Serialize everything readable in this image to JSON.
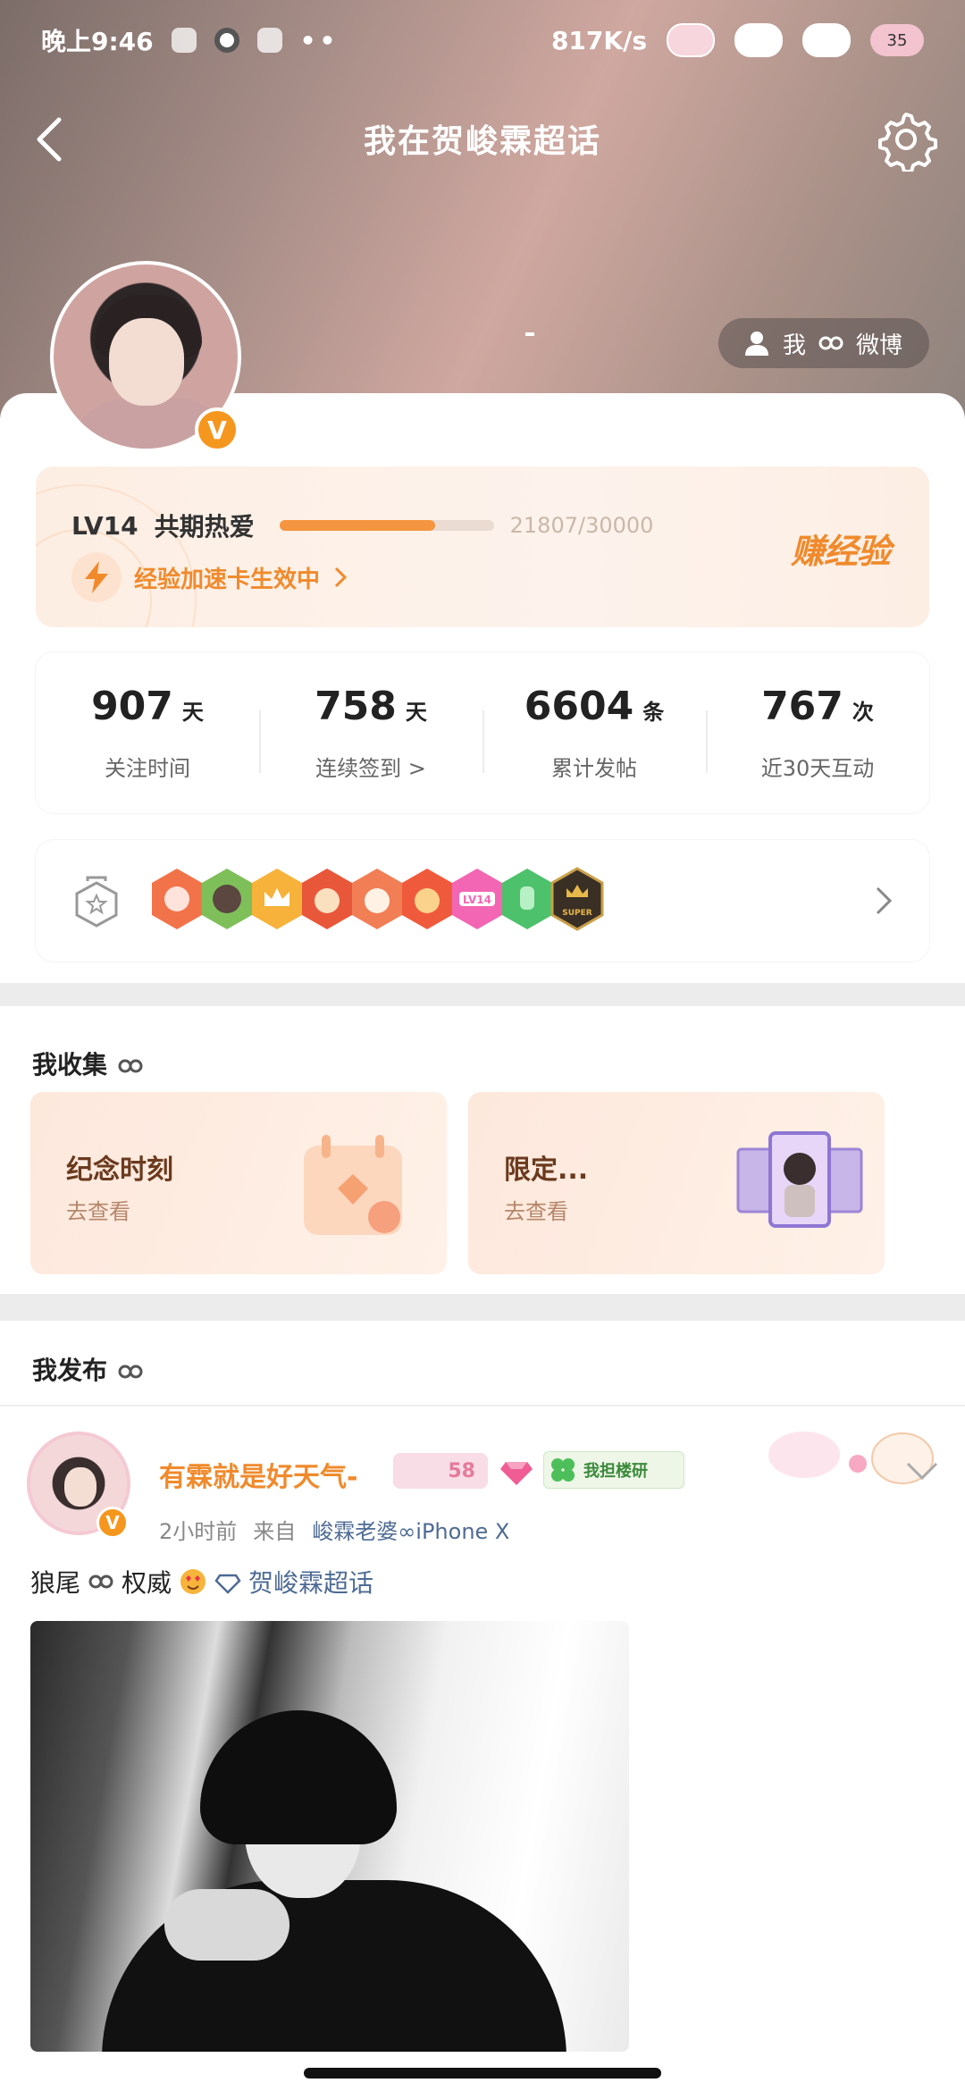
{
  "status_bar": {
    "time": "晚上9:46",
    "dots": "••",
    "network_speed": "817K/s",
    "battery": "35"
  },
  "nav": {
    "title": "我在贺峻霖超话"
  },
  "profile": {
    "weibo_button_label": "我",
    "weibo_button_suffix": "微博",
    "verified_badge": "V"
  },
  "experience": {
    "level": "LV14",
    "level_name": "共期热爱",
    "progress": 0.7269,
    "progress_text": "21807/30000",
    "boost_text": "经验加速卡生效中",
    "earn_label": "赚经验",
    "accent_color": "#f5953f"
  },
  "stats": [
    {
      "value": "907",
      "unit": "天",
      "label": "关注时间"
    },
    {
      "value": "758",
      "unit": "天",
      "label": "连续签到 >"
    },
    {
      "value": "6604",
      "unit": "条",
      "label": "累计发帖"
    },
    {
      "value": "767",
      "unit": "次",
      "label": "近30天互动"
    }
  ],
  "badges": {
    "items": [
      "badge-orange-wings",
      "badge-green-photo",
      "badge-gold-crown",
      "badge-cat-red",
      "badge-cat-orange",
      "badge-cat-flame",
      "badge-lv14-pink",
      "badge-hand-green",
      "badge-super-black"
    ],
    "lv_text": "LV14",
    "super_text": "SUPER"
  },
  "collection": {
    "title": "我收集",
    "cards": [
      {
        "title": "纪念时刻",
        "link": "去查看"
      },
      {
        "title": "限定...",
        "link": "去查看"
      }
    ]
  },
  "posts": {
    "title": "我发布",
    "items": [
      {
        "author": "有霖就是好天气-",
        "level_tag": "58",
        "guard_tag": "我担楼研",
        "time": "2小时前",
        "from_label": "来自",
        "source": "峻霖老婆",
        "device": "iPhone X",
        "text": "狼尾",
        "text2": "权威",
        "topic": "贺峻霖超话"
      }
    ]
  }
}
